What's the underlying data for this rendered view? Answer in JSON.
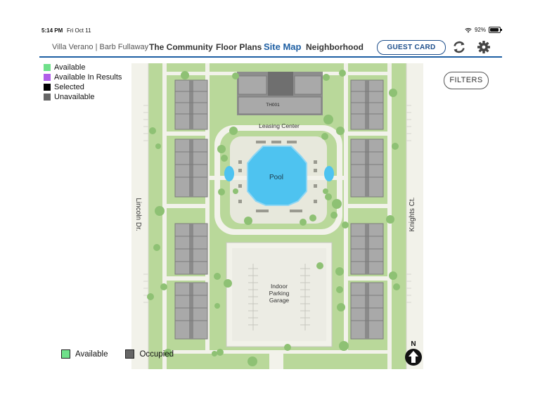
{
  "status": {
    "time": "5:14 PM",
    "date": "Fri Oct 11",
    "battery": "92%",
    "battery_level": 0.92
  },
  "nav": {
    "property": "Villa Verano | Barb Fullaway",
    "items": [
      "The Community",
      "Floor Plans",
      "Site Map",
      "Neighborhood"
    ],
    "active": "Site Map",
    "guest_card": "GUEST CARD",
    "refresh_icon": "refresh-icon",
    "settings_icon": "gear-icon"
  },
  "legend_top": [
    {
      "label": "Available",
      "color": "#6fe08a"
    },
    {
      "label": "Available In Results",
      "color": "#b05fe8"
    },
    {
      "label": "Selected",
      "color": "#000000"
    },
    {
      "label": "Unavailable",
      "color": "#666666"
    }
  ],
  "legend_bottom": [
    {
      "label": "Available",
      "color": "#6fe08a"
    },
    {
      "label": "Occupied",
      "color": "#666666"
    }
  ],
  "filters": "FILTERS",
  "map": {
    "streets": {
      "west": "Lincoln Dr.",
      "east": "Knights Ct."
    },
    "building_label": "TH001",
    "leasing_center": "Leasing Center",
    "pool": "Pool",
    "garage": [
      "Indoor",
      "Parking",
      "Garage"
    ],
    "north": "N",
    "colors": {
      "grass": "#b9d89a",
      "path": "#f2f2ea",
      "unit": "#a9a9a9",
      "water": "#4ec3f0"
    }
  }
}
